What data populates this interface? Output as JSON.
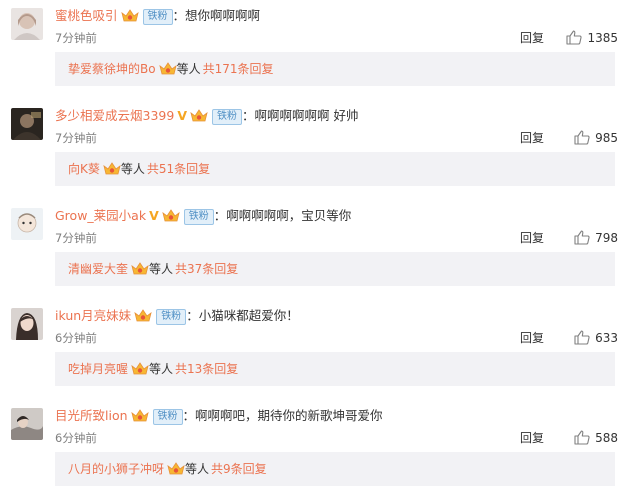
{
  "ui": {
    "reply_label": "回复",
    "others_label": "等人",
    "fan_badge_label": "铁粉"
  },
  "comments": [
    {
      "username": "蜜桃色吸引",
      "verified": false,
      "text": "：想你啊啊啊啊",
      "time": "7分钟前",
      "likes": "1385",
      "sub_name": "挚爱蔡徐坤的Bo",
      "sub_count": "共171条回复"
    },
    {
      "username": "多少相爱成云烟3399",
      "verified": true,
      "text": "：啊啊啊啊啊啊  好帅",
      "time": "7分钟前",
      "likes": "985",
      "sub_name": "向K葵",
      "sub_count": "共51条回复"
    },
    {
      "username": "Grow_莱园小ak",
      "verified": true,
      "text": "：啊啊啊啊啊，宝贝等你",
      "time": "7分钟前",
      "likes": "798",
      "sub_name": "清幽爱大奎",
      "sub_count": "共37条回复"
    },
    {
      "username": "ikun月亮妹妹",
      "verified": false,
      "text": "：小猫咪都超爱你！",
      "time": "6分钟前",
      "likes": "633",
      "sub_name": "吃掉月亮喔",
      "sub_count": "共13条回复"
    },
    {
      "username": "目光所致lion",
      "verified": false,
      "text": "：啊啊啊吧，期待你的新歌坤哥爱你",
      "time": "6分钟前",
      "likes": "588",
      "sub_name": "八月的小狮子冲呀",
      "sub_count": "共9条回复"
    }
  ]
}
